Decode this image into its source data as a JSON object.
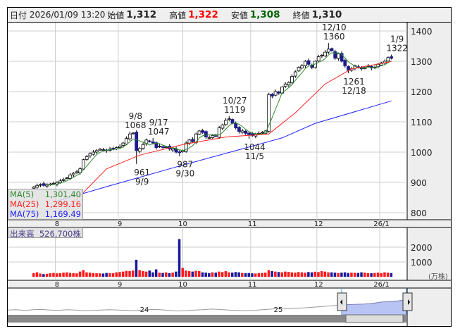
{
  "header": {
    "date_label": "日付",
    "datetime": "2026/01/09 13:20",
    "open_label": "始値",
    "open": "1,312",
    "high_label": "高値",
    "high": "1,322",
    "low_label": "安値",
    "low": "1,308",
    "close_label": "終値",
    "close": "1,310"
  },
  "colors": {
    "up_border": "#000000",
    "down_fill": "#1c1c8e",
    "ma5": "#2e8b2e",
    "ma25": "#ff2020",
    "ma75": "#2020ff",
    "vol_up": "#ff1a1a",
    "vol_down": "#1a1a9a",
    "high": "#ff0000",
    "low": "#006400"
  },
  "legend": [
    {
      "label": "MA(5)",
      "value": "1,301.40"
    },
    {
      "label": "MA(25)",
      "value": "1,299.16"
    },
    {
      "label": "MA(75)",
      "value": "1,169.49"
    }
  ],
  "volume_label": {
    "label": "出来高",
    "value": "526,700株"
  },
  "chart_data": {
    "type": "candlestick",
    "price_ticks": [
      "1400",
      "1300",
      "1200",
      "1100",
      "1000",
      "900",
      "800"
    ],
    "price_tick_values": [
      1400,
      1300,
      1200,
      1100,
      1000,
      900,
      800
    ],
    "month_labels": [
      {
        "label": "8",
        "index": 7
      },
      {
        "label": "9",
        "index": 26
      },
      {
        "label": "10",
        "index": 45
      },
      {
        "label": "11",
        "index": 66
      },
      {
        "label": "12",
        "index": 86
      },
      {
        "label": "26/1",
        "index": 105
      }
    ],
    "month_grid_index": [
      6.5,
      25.5,
      45,
      65.5,
      85.5,
      104.5
    ],
    "close": [
      885,
      890,
      893,
      890,
      892,
      895,
      897,
      900,
      905,
      910,
      915,
      925,
      930,
      935,
      945,
      975,
      985,
      995,
      1000,
      1005,
      1010,
      1008,
      1005,
      1010,
      1012,
      1015,
      1020,
      1030,
      1045,
      1060,
      1063,
      1005,
      1012,
      1025,
      1040,
      1035,
      1030,
      1015,
      1020,
      1015,
      1018,
      1010,
      1012,
      1000,
      998,
      1005,
      1030,
      1040,
      1035,
      1060,
      1070,
      1065,
      1050,
      1048,
      1055,
      1052,
      1080,
      1090,
      1105,
      1110,
      1095,
      1080,
      1068,
      1070,
      1062,
      1058,
      1055,
      1060,
      1062,
      1065,
      1070,
      1190,
      1185,
      1200,
      1195,
      1215,
      1225,
      1230,
      1250,
      1265,
      1280,
      1285,
      1300,
      1290,
      1280,
      1300,
      1315,
      1320,
      1330,
      1340,
      1335,
      1310,
      1325,
      1300,
      1285,
      1270,
      1275,
      1285,
      1280,
      1275,
      1280,
      1285,
      1278,
      1280,
      1290,
      1295,
      1300,
      1312,
      1310
    ],
    "ma25": [
      [
        9,
        800
      ],
      [
        22,
        945
      ],
      [
        32,
        990
      ],
      [
        45,
        1025
      ],
      [
        58,
        1050
      ],
      [
        71,
        1060
      ],
      [
        79,
        1130
      ],
      [
        88,
        1225
      ],
      [
        96,
        1275
      ],
      [
        108,
        1299
      ]
    ],
    "ma75": [
      [
        6,
        835
      ],
      [
        22,
        886
      ],
      [
        43,
        951
      ],
      [
        64,
        1014
      ],
      [
        75,
        1047
      ],
      [
        85,
        1095
      ],
      [
        108,
        1169
      ]
    ],
    "annotations": [
      {
        "index": 29,
        "value": 1068,
        "pos": "above",
        "l1": "9/8",
        "l2": "1068"
      },
      {
        "index": 36,
        "value": 1047,
        "pos": "above",
        "l1": "9/17",
        "l2": "1047"
      },
      {
        "index": 31,
        "value": 961,
        "pos": "below",
        "l1": "961",
        "l2": "9/9"
      },
      {
        "index": 44,
        "value": 987,
        "pos": "below",
        "l1": "987",
        "l2": "9/30"
      },
      {
        "index": 59,
        "value": 1119,
        "pos": "above",
        "l1": "10/27",
        "l2": "1119"
      },
      {
        "index": 65,
        "value": 1044,
        "pos": "below",
        "l1": "1044",
        "l2": "11/5"
      },
      {
        "index": 89,
        "value": 1360,
        "pos": "above",
        "l1": "12/10",
        "l2": "1360"
      },
      {
        "index": 95,
        "value": 1261,
        "pos": "below",
        "l1": "1261",
        "l2": "12/18"
      },
      {
        "index": 108,
        "value": 1322,
        "pos": "above",
        "l1": "1/9",
        "l2": "1322"
      }
    ],
    "volume": [
      250,
      300,
      220,
      180,
      200,
      240,
      260,
      230,
      250,
      280,
      300,
      260,
      240,
      230,
      350,
      450,
      300,
      280,
      250,
      240,
      230,
      220,
      260,
      250,
      240,
      300,
      320,
      350,
      400,
      380,
      420,
      1150,
      450,
      380,
      350,
      420,
      300,
      500,
      280,
      260,
      300,
      250,
      280,
      350,
      2550,
      600,
      420,
      380,
      350,
      400,
      380,
      300,
      280,
      250,
      300,
      280,
      350,
      320,
      380,
      300,
      280,
      320,
      300,
      260,
      240,
      250,
      230,
      220,
      240,
      260,
      280,
      450,
      380,
      350,
      320,
      300,
      350,
      330,
      300,
      280,
      320,
      300,
      280,
      320,
      300,
      340,
      320,
      380,
      350,
      300,
      300,
      280,
      260,
      280,
      300,
      260,
      280,
      270,
      260,
      300,
      280,
      250,
      240,
      260,
      280,
      250,
      300,
      280,
      250
    ],
    "volume_ticks": [
      "2000",
      "1000"
    ],
    "volume_tick_values": [
      2000,
      1000
    ],
    "volume_unit": "(万株)",
    "navigator": {
      "labels": [
        "24",
        "25"
      ],
      "series": [
        45,
        46,
        44,
        46,
        47,
        45,
        44,
        46,
        45,
        43,
        44,
        45,
        46,
        45,
        44,
        43,
        45,
        47,
        46,
        44,
        42,
        43,
        45,
        46,
        48,
        47,
        45,
        44,
        43,
        44,
        46,
        48,
        50,
        49,
        51,
        52,
        54,
        56,
        58,
        60,
        62,
        63,
        64,
        66,
        70,
        72,
        74,
        78
      ]
    }
  }
}
